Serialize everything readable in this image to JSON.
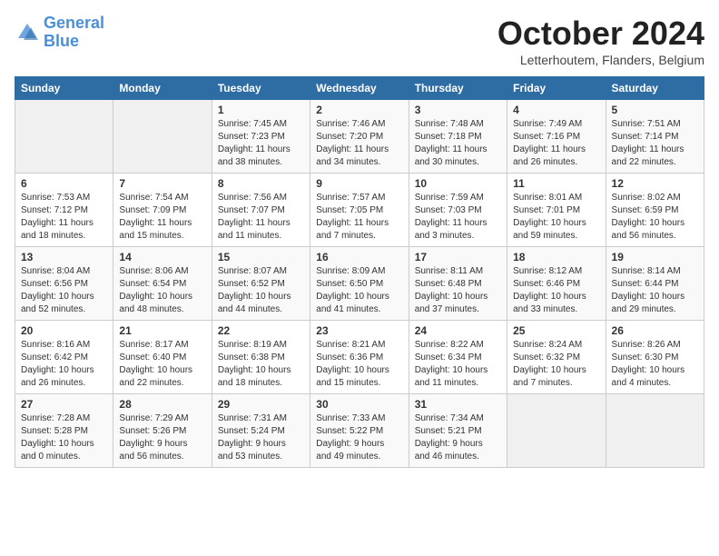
{
  "header": {
    "logo_line1": "General",
    "logo_line2": "Blue",
    "month_title": "October 2024",
    "location": "Letterhoutem, Flanders, Belgium"
  },
  "days_of_week": [
    "Sunday",
    "Monday",
    "Tuesday",
    "Wednesday",
    "Thursday",
    "Friday",
    "Saturday"
  ],
  "weeks": [
    [
      {
        "day": "",
        "info": ""
      },
      {
        "day": "",
        "info": ""
      },
      {
        "day": "1",
        "info": "Sunrise: 7:45 AM\nSunset: 7:23 PM\nDaylight: 11 hours\nand 38 minutes."
      },
      {
        "day": "2",
        "info": "Sunrise: 7:46 AM\nSunset: 7:20 PM\nDaylight: 11 hours\nand 34 minutes."
      },
      {
        "day": "3",
        "info": "Sunrise: 7:48 AM\nSunset: 7:18 PM\nDaylight: 11 hours\nand 30 minutes."
      },
      {
        "day": "4",
        "info": "Sunrise: 7:49 AM\nSunset: 7:16 PM\nDaylight: 11 hours\nand 26 minutes."
      },
      {
        "day": "5",
        "info": "Sunrise: 7:51 AM\nSunset: 7:14 PM\nDaylight: 11 hours\nand 22 minutes."
      }
    ],
    [
      {
        "day": "6",
        "info": "Sunrise: 7:53 AM\nSunset: 7:12 PM\nDaylight: 11 hours\nand 18 minutes."
      },
      {
        "day": "7",
        "info": "Sunrise: 7:54 AM\nSunset: 7:09 PM\nDaylight: 11 hours\nand 15 minutes."
      },
      {
        "day": "8",
        "info": "Sunrise: 7:56 AM\nSunset: 7:07 PM\nDaylight: 11 hours\nand 11 minutes."
      },
      {
        "day": "9",
        "info": "Sunrise: 7:57 AM\nSunset: 7:05 PM\nDaylight: 11 hours\nand 7 minutes."
      },
      {
        "day": "10",
        "info": "Sunrise: 7:59 AM\nSunset: 7:03 PM\nDaylight: 11 hours\nand 3 minutes."
      },
      {
        "day": "11",
        "info": "Sunrise: 8:01 AM\nSunset: 7:01 PM\nDaylight: 10 hours\nand 59 minutes."
      },
      {
        "day": "12",
        "info": "Sunrise: 8:02 AM\nSunset: 6:59 PM\nDaylight: 10 hours\nand 56 minutes."
      }
    ],
    [
      {
        "day": "13",
        "info": "Sunrise: 8:04 AM\nSunset: 6:56 PM\nDaylight: 10 hours\nand 52 minutes."
      },
      {
        "day": "14",
        "info": "Sunrise: 8:06 AM\nSunset: 6:54 PM\nDaylight: 10 hours\nand 48 minutes."
      },
      {
        "day": "15",
        "info": "Sunrise: 8:07 AM\nSunset: 6:52 PM\nDaylight: 10 hours\nand 44 minutes."
      },
      {
        "day": "16",
        "info": "Sunrise: 8:09 AM\nSunset: 6:50 PM\nDaylight: 10 hours\nand 41 minutes."
      },
      {
        "day": "17",
        "info": "Sunrise: 8:11 AM\nSunset: 6:48 PM\nDaylight: 10 hours\nand 37 minutes."
      },
      {
        "day": "18",
        "info": "Sunrise: 8:12 AM\nSunset: 6:46 PM\nDaylight: 10 hours\nand 33 minutes."
      },
      {
        "day": "19",
        "info": "Sunrise: 8:14 AM\nSunset: 6:44 PM\nDaylight: 10 hours\nand 29 minutes."
      }
    ],
    [
      {
        "day": "20",
        "info": "Sunrise: 8:16 AM\nSunset: 6:42 PM\nDaylight: 10 hours\nand 26 minutes."
      },
      {
        "day": "21",
        "info": "Sunrise: 8:17 AM\nSunset: 6:40 PM\nDaylight: 10 hours\nand 22 minutes."
      },
      {
        "day": "22",
        "info": "Sunrise: 8:19 AM\nSunset: 6:38 PM\nDaylight: 10 hours\nand 18 minutes."
      },
      {
        "day": "23",
        "info": "Sunrise: 8:21 AM\nSunset: 6:36 PM\nDaylight: 10 hours\nand 15 minutes."
      },
      {
        "day": "24",
        "info": "Sunrise: 8:22 AM\nSunset: 6:34 PM\nDaylight: 10 hours\nand 11 minutes."
      },
      {
        "day": "25",
        "info": "Sunrise: 8:24 AM\nSunset: 6:32 PM\nDaylight: 10 hours\nand 7 minutes."
      },
      {
        "day": "26",
        "info": "Sunrise: 8:26 AM\nSunset: 6:30 PM\nDaylight: 10 hours\nand 4 minutes."
      }
    ],
    [
      {
        "day": "27",
        "info": "Sunrise: 7:28 AM\nSunset: 5:28 PM\nDaylight: 10 hours\nand 0 minutes."
      },
      {
        "day": "28",
        "info": "Sunrise: 7:29 AM\nSunset: 5:26 PM\nDaylight: 9 hours\nand 56 minutes."
      },
      {
        "day": "29",
        "info": "Sunrise: 7:31 AM\nSunset: 5:24 PM\nDaylight: 9 hours\nand 53 minutes."
      },
      {
        "day": "30",
        "info": "Sunrise: 7:33 AM\nSunset: 5:22 PM\nDaylight: 9 hours\nand 49 minutes."
      },
      {
        "day": "31",
        "info": "Sunrise: 7:34 AM\nSunset: 5:21 PM\nDaylight: 9 hours\nand 46 minutes."
      },
      {
        "day": "",
        "info": ""
      },
      {
        "day": "",
        "info": ""
      }
    ]
  ]
}
